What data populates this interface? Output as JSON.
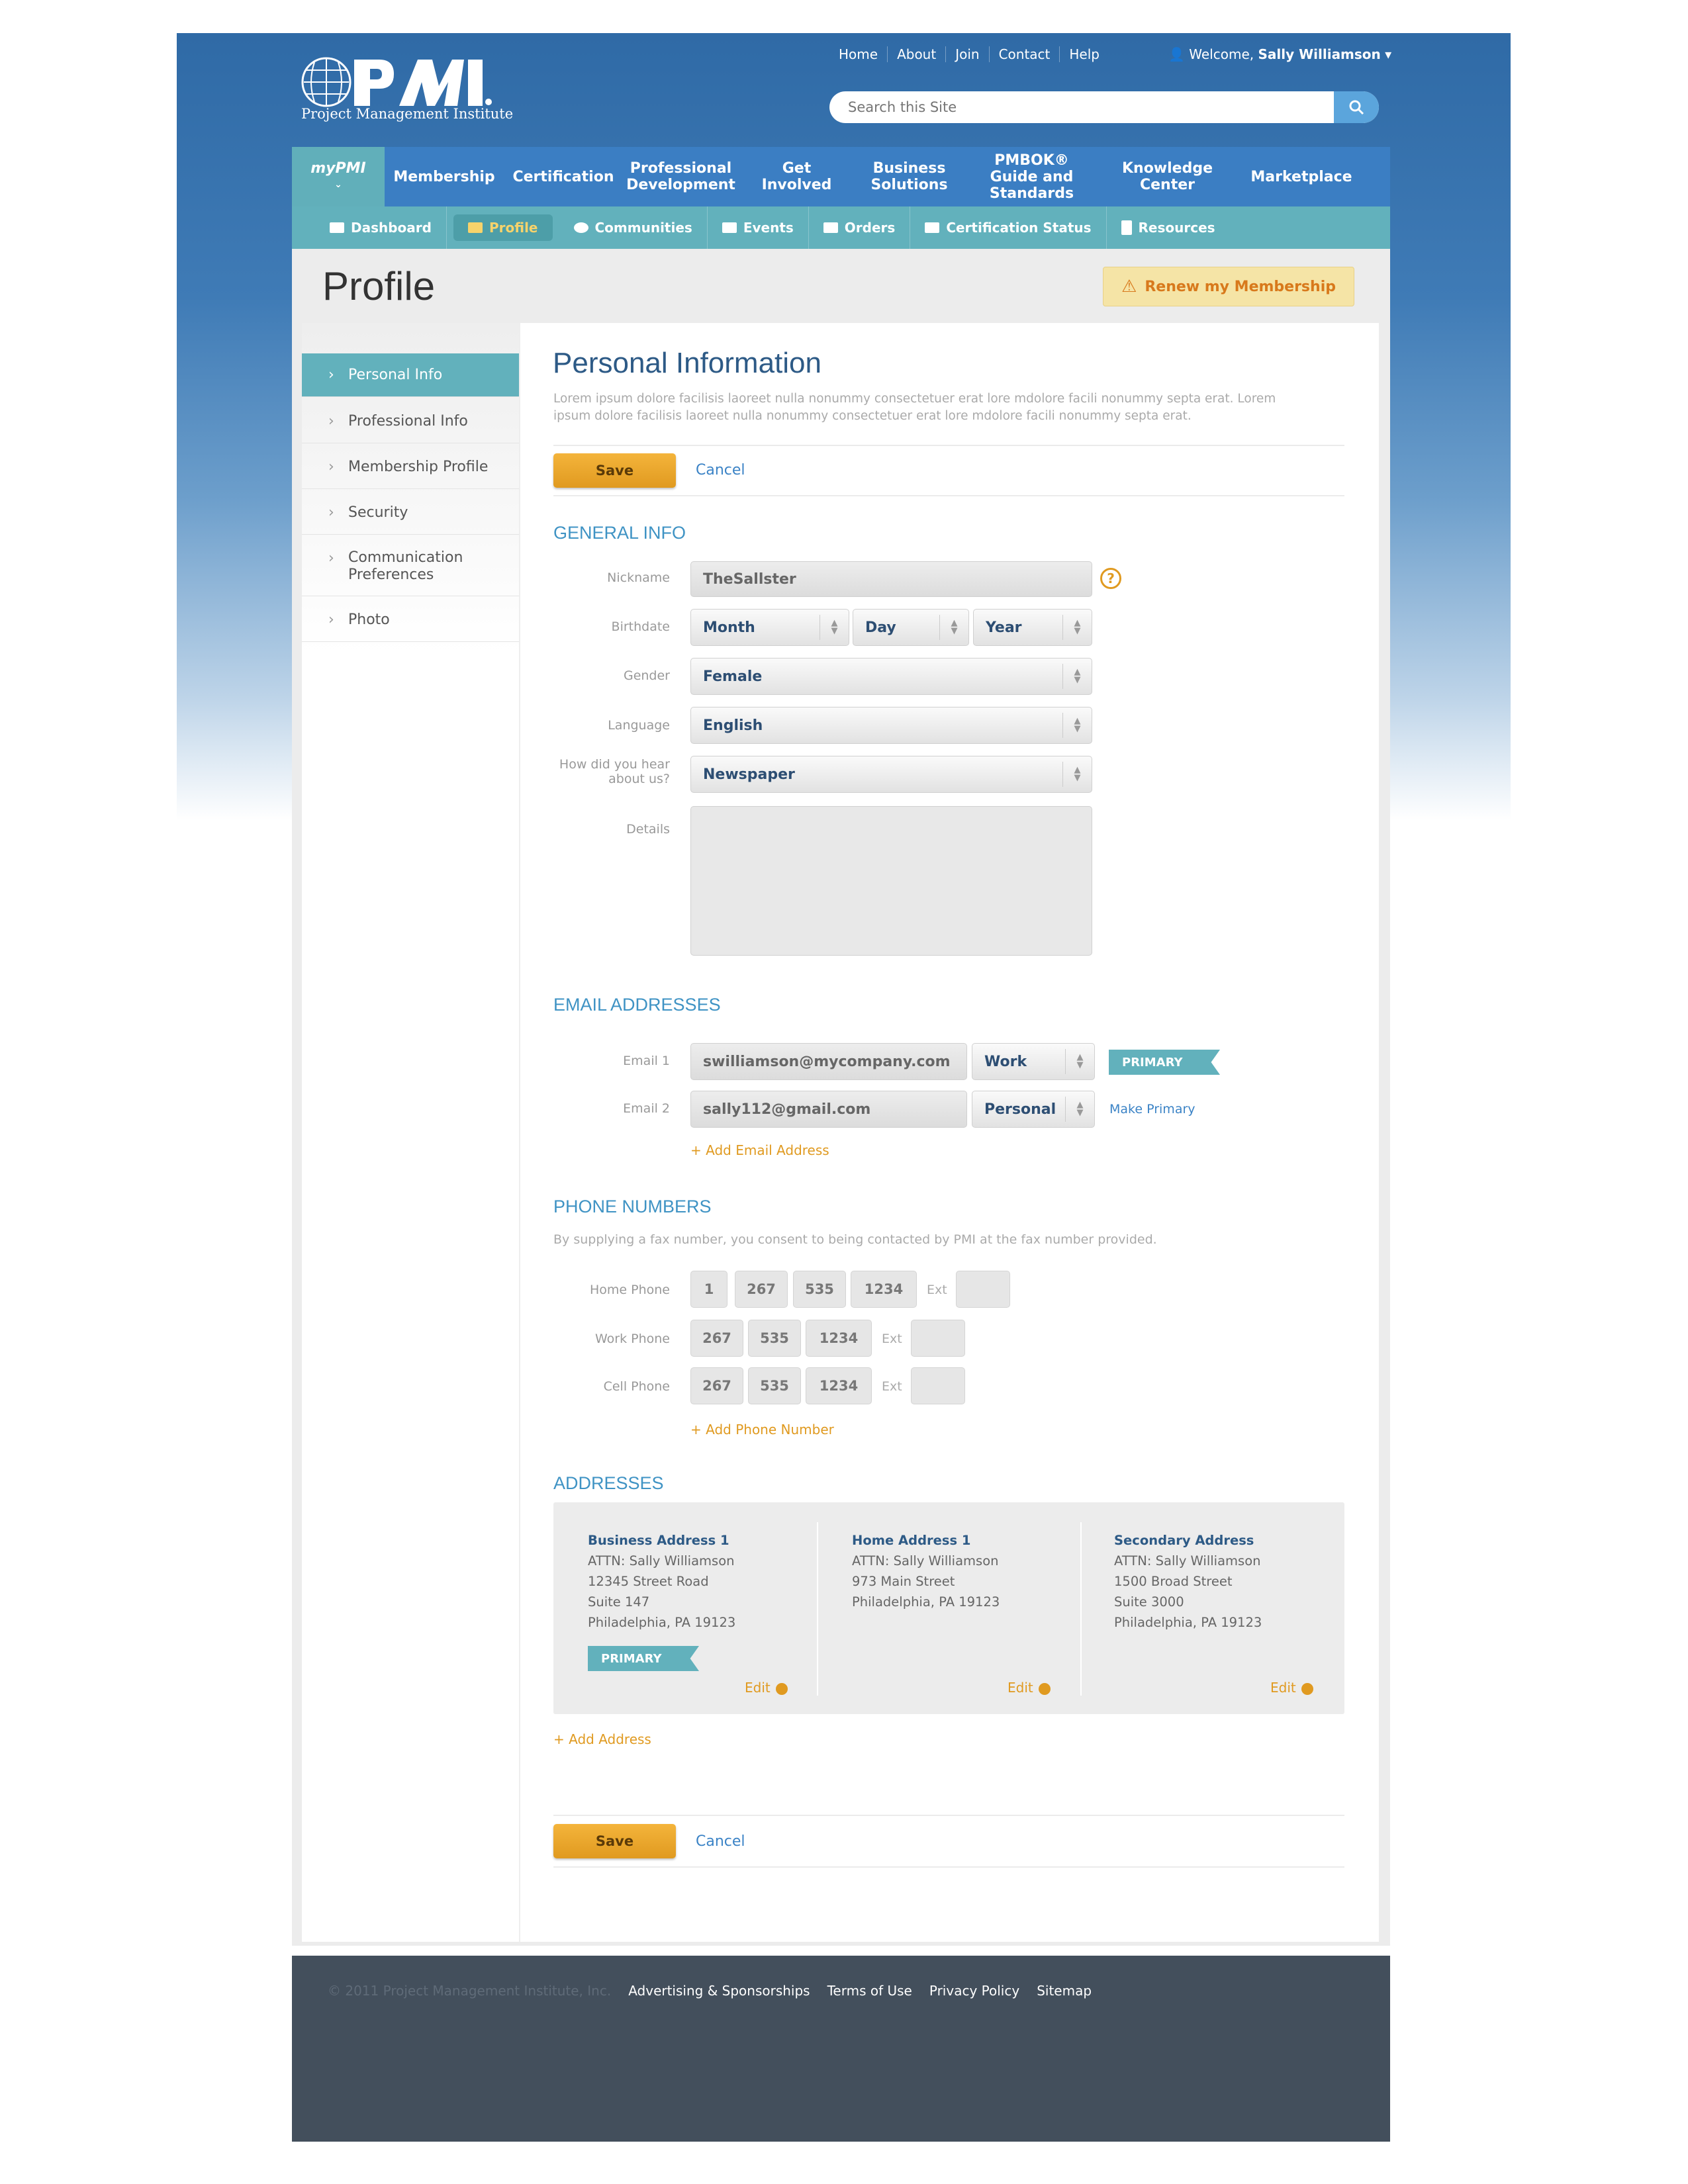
{
  "header": {
    "logo_text": "Project Management Institute",
    "top_links": [
      "Home",
      "About",
      "Join",
      "Contact",
      "Help"
    ],
    "welcome_prefix": "Welcome,",
    "welcome_user": "Sally Williamson",
    "search_placeholder": "Search this Site"
  },
  "main_nav": [
    {
      "label": "myPMI"
    },
    {
      "label": "Membership"
    },
    {
      "label": "Certification"
    },
    {
      "label": "Professional Development"
    },
    {
      "label": "Get Involved"
    },
    {
      "label": "Business Solutions"
    },
    {
      "label": "PMBOK® Guide and Standards"
    },
    {
      "label": "Knowledge Center"
    },
    {
      "label": "Marketplace"
    }
  ],
  "sub_nav": [
    {
      "label": "Dashboard"
    },
    {
      "label": "Profile"
    },
    {
      "label": "Communities"
    },
    {
      "label": "Events"
    },
    {
      "label": "Orders"
    },
    {
      "label": "Certification Status"
    },
    {
      "label": "Resources"
    }
  ],
  "page": {
    "title": "Profile",
    "renew_label": "Renew my Membership"
  },
  "sidebar": [
    {
      "label": "Personal Info"
    },
    {
      "label": "Professional Info"
    },
    {
      "label": "Membership Profile"
    },
    {
      "label": "Security"
    },
    {
      "label": "Communication Preferences"
    },
    {
      "label": "Photo"
    }
  ],
  "main": {
    "heading": "Personal Information",
    "intro": "Lorem ipsum dolore facilisis laoreet nulla nonummy consectetuer erat lore mdolore facili nonummy septa erat. Lorem ipsum dolore facilisis laoreet nulla nonummy consectetuer erat lore mdolore facili nonummy septa erat.",
    "save_label": "Save",
    "cancel_label": "Cancel"
  },
  "general": {
    "title": "GENERAL INFO",
    "nickname_label": "Nickname",
    "nickname_value": "TheSallster",
    "birthdate_label": "Birthdate",
    "month": "Month",
    "day": "Day",
    "year": "Year",
    "gender_label": "Gender",
    "gender_value": "Female",
    "language_label": "Language",
    "language_value": "English",
    "hear_label": "How did you hear about us?",
    "hear_value": "Newspaper",
    "details_label": "Details"
  },
  "email": {
    "title": "EMAIL ADDRESSES",
    "email1_label": "Email 1",
    "email1_value": "swilliamson@mycompany.com",
    "email1_type": "Work",
    "primary_label": "PRIMARY",
    "email2_label": "Email 2",
    "email2_value": "sally112@gmail.com",
    "email2_type": "Personal",
    "make_primary": "Make Primary",
    "add_label": "Add Email Address"
  },
  "phone": {
    "title": "PHONE NUMBERS",
    "note": "By supplying a fax number, you consent to being contacted by PMI at the fax number provided.",
    "home_label": "Home Phone",
    "home": [
      "1",
      "267",
      "535",
      "1234"
    ],
    "work_label": "Work Phone",
    "work": [
      "267",
      "535",
      "1234"
    ],
    "cell_label": "Cell Phone",
    "cell": [
      "267",
      "535",
      "1234"
    ],
    "ext_label": "Ext",
    "add_label": "Add Phone Number"
  },
  "addresses": {
    "title": "ADDRESSES",
    "items": [
      {
        "name": "Business Address 1",
        "lines": [
          "ATTN: Sally Williamson",
          "12345 Street Road",
          "Suite 147",
          "Philadelphia, PA 19123"
        ]
      },
      {
        "name": "Home Address 1",
        "lines": [
          "ATTN: Sally Williamson",
          "973 Main Street",
          "Philadelphia, PA 19123"
        ]
      },
      {
        "name": "Secondary Address",
        "lines": [
          "ATTN: Sally Williamson",
          "1500 Broad Street",
          "Suite 3000",
          "Philadelphia, PA 19123"
        ]
      }
    ],
    "primary_label": "PRIMARY",
    "edit_label": "Edit",
    "add_label": "Add Address"
  },
  "footer": {
    "copyright": "© 2011 Project Management Institute, Inc.",
    "links": [
      "Advertising & Sponsorships",
      "Terms of Use",
      "Privacy Policy",
      "Sitemap"
    ]
  },
  "colors": {
    "brand_blue": "#3b7ec3",
    "teal": "#62b1bc",
    "accent_orange": "#e09a20",
    "footer_bg": "#434f5c"
  }
}
